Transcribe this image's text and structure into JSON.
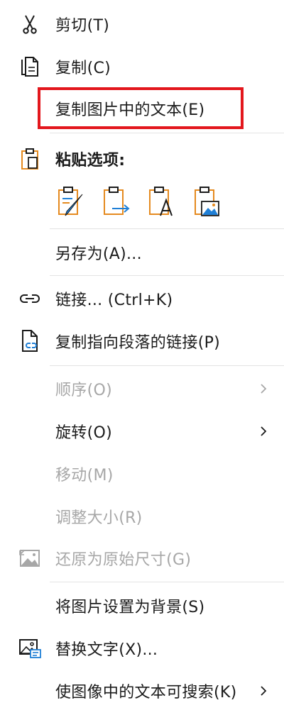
{
  "menu": {
    "cut": "剪切(T)",
    "copy": "复制(C)",
    "copy_text_from_picture": "复制图片中的文本(E)",
    "paste_options_header": "粘贴选项:",
    "save_as": "另存为(A)...",
    "link": "链接...   (Ctrl+K)",
    "copy_link_to_paragraph": "复制指向段落的链接(P)",
    "order": "顺序(O)",
    "rotate": "旋转(O)",
    "move": "移动(M)",
    "resize": "调整大小(R)",
    "reset_to_original_size": "还原为原始尺寸(G)",
    "set_picture_as_background": "将图片设置为背景(S)",
    "alt_text": "替换文字(X)...",
    "make_text_searchable": "使图像中的文本可搜索(K)"
  },
  "paste_buttons": [
    {
      "name": "paste-keep-formatting-icon"
    },
    {
      "name": "paste-merge-formatting-icon"
    },
    {
      "name": "paste-keep-text-only-icon"
    },
    {
      "name": "paste-picture-icon"
    }
  ],
  "colors": {
    "highlight_border": "#e3171d",
    "accent_blue": "#1f7fd6",
    "accent_orange": "#e58a1f",
    "disabled_text": "#a7a7a7"
  }
}
